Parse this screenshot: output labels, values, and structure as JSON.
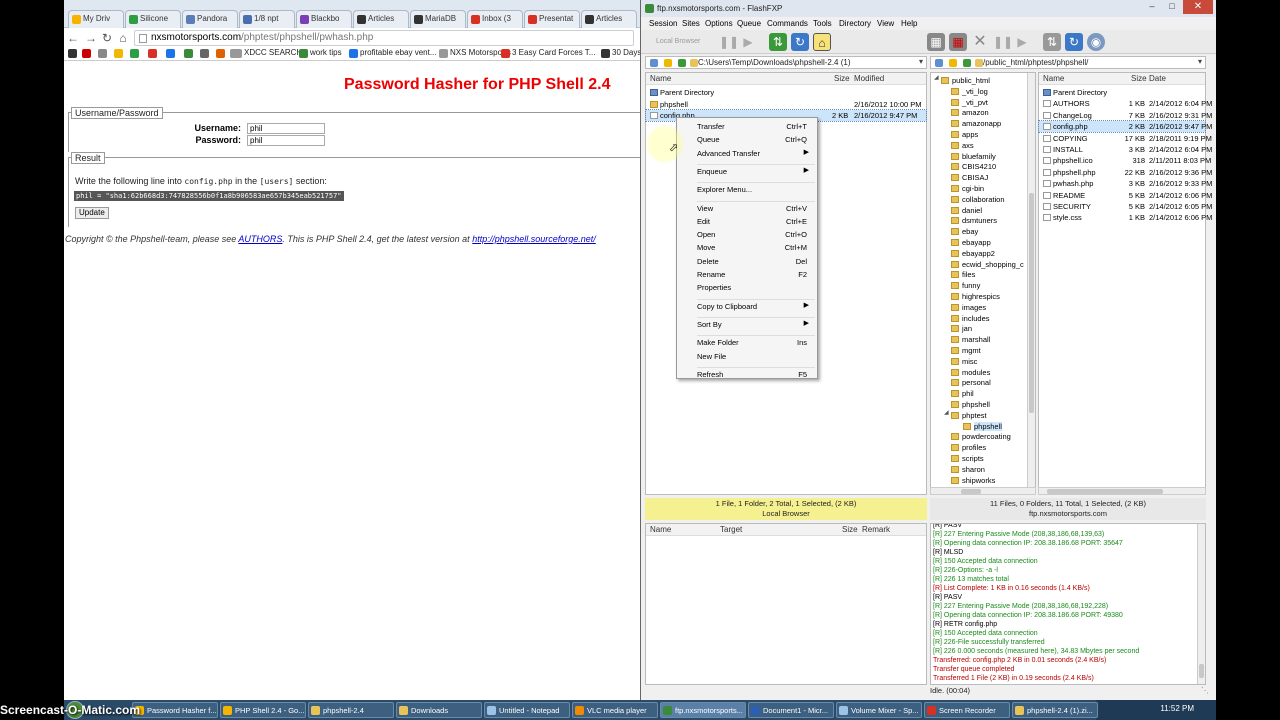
{
  "browser": {
    "tabs": [
      {
        "label": "My Driv",
        "color": "#f4b400"
      },
      {
        "label": "Silicone",
        "color": "#2e9e44"
      },
      {
        "label": "Pandora",
        "color": "#5a7db6"
      },
      {
        "label": "1/8 npt",
        "color": "#4a6fb0"
      },
      {
        "label": "Blackbo",
        "color": "#7a3fb8"
      },
      {
        "label": "Articles",
        "color": "#333333"
      },
      {
        "label": "MariaDB",
        "color": "#333333"
      },
      {
        "label": "Inbox (3",
        "color": "#d93025"
      },
      {
        "label": "Presentat",
        "color": "#d93025"
      },
      {
        "label": "Articles",
        "color": "#333333"
      }
    ],
    "url_host": "nxsmotorsports.com",
    "url_path": "/phptest/phpshell/pwhash.php",
    "bookmarks": [
      {
        "label": "XDCC SEARCH",
        "color": "#999999"
      },
      {
        "label": "work tips",
        "color": "#3a8a3a"
      },
      {
        "label": "profitable ebay vent...",
        "color": "#1a73e8"
      },
      {
        "label": "NXS Motorsports",
        "color": "#999999"
      },
      {
        "label": "3 Easy Card Forces T...",
        "color": "#d93025"
      },
      {
        "label": "30 Days",
        "color": "#333333"
      }
    ],
    "page": {
      "title": "Password Hasher for PHP Shell 2.4",
      "fieldset1_legend": "Username/Password",
      "username_label": "Username:",
      "username_value": "phil",
      "password_label": "Password:",
      "password_value": "phil",
      "fieldset2_legend": "Result",
      "result_pre": "Write the following line into",
      "result_code1": "config.php",
      "result_mid": "in the",
      "result_code2": "[users]",
      "result_post": "section:",
      "hash_line": "phil = \"sha1:62b668d3:747828556b0f1a8b906583ae657b345eab521757\"",
      "update_button": "Update",
      "footer_pre": "Copyright © the Phpshell-team, please see",
      "footer_link1": "AUTHORS",
      "footer_mid": ". This is PHP Shell 2.4, get the latest version at",
      "footer_link2": "http://phpshell.sourceforge.net/"
    }
  },
  "fxp": {
    "title": "ftp.nxsmotorsports.com - FlashFXP",
    "menu": [
      "Session",
      "Sites",
      "Options",
      "Queue",
      "Commands",
      "Tools",
      "Directory",
      "View",
      "Help"
    ],
    "local_browser_label": "Local Browser",
    "local_path": "C:\\Users\\Temp\\Downloads\\phpshell-2.4 (1)",
    "remote_path": "/public_html/phptest/phpshell/",
    "local_headers": {
      "name": "Name",
      "size": "Size",
      "modified": "Modified"
    },
    "local_files": [
      {
        "name": "Parent Directory",
        "size": "",
        "modified": "",
        "kind": "updir"
      },
      {
        "name": "phpshell",
        "size": "",
        "modified": "2/16/2012 10:00 PM",
        "kind": "folder"
      },
      {
        "name": "config.php",
        "size": "2 KB",
        "modified": "2/16/2012 9:47 PM",
        "kind": "file"
      }
    ],
    "tree": [
      "public_html",
      "_vti_log",
      "_vti_pvt",
      "amazon",
      "amazonapp",
      "apps",
      "axs",
      "bluefamily",
      "CBIS4210",
      "CBISAJ",
      "cgi-bin",
      "collaboration",
      "daniel",
      "dsmtuners",
      "ebay",
      "ebayapp",
      "ebayapp2",
      "ecwid_shopping_c",
      "files",
      "funny",
      "highrespics",
      "images",
      "includes",
      "jan",
      "marshall",
      "mgmt",
      "misc",
      "modules",
      "personal",
      "phil",
      "phpshell",
      "phptest",
      "phpshell",
      "powdercoating",
      "profiles",
      "scripts",
      "sharon",
      "shipworks"
    ],
    "remote_headers": {
      "name": "Name",
      "size": "Size",
      "date": "Date"
    },
    "remote_files": [
      {
        "name": "Parent Directory",
        "size": "",
        "date": "",
        "kind": "updir"
      },
      {
        "name": "AUTHORS",
        "size": "1 KB",
        "date": "2/14/2012 6:04 PM",
        "kind": "file"
      },
      {
        "name": "ChangeLog",
        "size": "7 KB",
        "date": "2/16/2012 9:31 PM",
        "kind": "file"
      },
      {
        "name": "config.php",
        "size": "2 KB",
        "date": "2/16/2012 9:47 PM",
        "kind": "file"
      },
      {
        "name": "COPYING",
        "size": "17 KB",
        "date": "2/18/2011 9:19 PM",
        "kind": "file"
      },
      {
        "name": "INSTALL",
        "size": "3 KB",
        "date": "2/14/2012 6:04 PM",
        "kind": "file"
      },
      {
        "name": "phpshell.ico",
        "size": "318",
        "date": "2/11/2011 8:03 PM",
        "kind": "file"
      },
      {
        "name": "phpshell.php",
        "size": "22 KB",
        "date": "2/16/2012 9:36 PM",
        "kind": "file"
      },
      {
        "name": "pwhash.php",
        "size": "3 KB",
        "date": "2/16/2012 9:33 PM",
        "kind": "file"
      },
      {
        "name": "README",
        "size": "5 KB",
        "date": "2/14/2012 6:06 PM",
        "kind": "file"
      },
      {
        "name": "SECURITY",
        "size": "5 KB",
        "date": "2/14/2012 6:05 PM",
        "kind": "file"
      },
      {
        "name": "style.css",
        "size": "1 KB",
        "date": "2/14/2012 6:06 PM",
        "kind": "file"
      }
    ],
    "local_status_line1": "1 File, 1 Folder, 2 Total, 1 Selected, (2 KB)",
    "local_status_line2": "Local Browser",
    "remote_status_line1": "11 Files, 0 Folders, 11 Total, 1 Selected, (2 KB)",
    "remote_status_line2": "ftp.nxsmotorsports.com",
    "queue_headers": {
      "name": "Name",
      "target": "Target",
      "size": "Size",
      "remark": "Remark"
    },
    "log": [
      {
        "text": "[R] PASV",
        "kind": "cmd"
      },
      {
        "text": "[R] 227 Entering Passive Mode (208,38,186,68,139,63)",
        "kind": "resp"
      },
      {
        "text": "[R] Opening data connection IP: 208.38.186.68 PORT: 35647",
        "kind": "resp"
      },
      {
        "text": "[R] MLSD",
        "kind": "cmd"
      },
      {
        "text": "[R] 150 Accepted data connection",
        "kind": "resp"
      },
      {
        "text": "[R] 226-Options: -a -l",
        "kind": "resp"
      },
      {
        "text": "[R] 226 13 matches total",
        "kind": "resp"
      },
      {
        "text": "[R] List Complete: 1 KB in 0.16 seconds (1.4 KB/s)",
        "kind": "local"
      },
      {
        "text": "[R] PASV",
        "kind": "cmd"
      },
      {
        "text": "[R] 227 Entering Passive Mode (208,38,186,68,192,228)",
        "kind": "resp"
      },
      {
        "text": "[R] Opening data connection IP: 208.38.186.68 PORT: 49380",
        "kind": "resp"
      },
      {
        "text": "[R] RETR config.php",
        "kind": "cmd"
      },
      {
        "text": "[R] 150 Accepted data connection",
        "kind": "resp"
      },
      {
        "text": "[R] 226-File successfully transferred",
        "kind": "resp"
      },
      {
        "text": "[R] 226 0.000 seconds (measured here), 34.83 Mbytes per second",
        "kind": "resp"
      },
      {
        "text": "Transferred: config.php 2 KB in 0.01 seconds (2.4 KB/s)",
        "kind": "local"
      },
      {
        "text": "Transfer queue completed",
        "kind": "local"
      },
      {
        "text": "Transferred 1 File (2 KB) in 0.19 seconds (2.4 KB/s)",
        "kind": "local"
      }
    ],
    "idle_status": "Idle. (00:04)"
  },
  "context_menu": [
    {
      "label": "Transfer",
      "key": "Ctrl+T",
      "arrow": false
    },
    {
      "label": "Queue",
      "key": "Ctrl+Q",
      "arrow": false
    },
    {
      "label": "Advanced Transfer",
      "key": "",
      "arrow": true
    },
    {
      "sep": true
    },
    {
      "label": "Enqueue",
      "key": "",
      "arrow": true
    },
    {
      "sep": true
    },
    {
      "label": "Explorer Menu...",
      "key": "",
      "arrow": false
    },
    {
      "sep": true
    },
    {
      "label": "View",
      "key": "Ctrl+V",
      "arrow": false
    },
    {
      "label": "Edit",
      "key": "Ctrl+E",
      "arrow": false
    },
    {
      "label": "Open",
      "key": "Ctrl+O",
      "arrow": false
    },
    {
      "label": "Move",
      "key": "Ctrl+M",
      "arrow": false
    },
    {
      "label": "Delete",
      "key": "Del",
      "arrow": false
    },
    {
      "label": "Rename",
      "key": "F2",
      "arrow": false
    },
    {
      "label": "Properties",
      "key": "",
      "arrow": false
    },
    {
      "sep": true
    },
    {
      "label": "Copy to Clipboard",
      "key": "",
      "arrow": true
    },
    {
      "sep": true
    },
    {
      "label": "Sort By",
      "key": "",
      "arrow": true
    },
    {
      "sep": true
    },
    {
      "label": "Make Folder",
      "key": "Ins",
      "arrow": false
    },
    {
      "label": "New File",
      "key": "",
      "arrow": false
    },
    {
      "sep": true
    },
    {
      "label": "Refresh",
      "key": "F5",
      "arrow": false
    }
  ],
  "taskbar": {
    "items": [
      {
        "label": "Password Hasher f...",
        "color": "#f4b400"
      },
      {
        "label": "PHP Shell 2.4 - Go...",
        "color": "#f4b400"
      },
      {
        "label": "phpshell-2.4",
        "color": "#e8c35a"
      },
      {
        "label": "Downloads",
        "color": "#e8c35a"
      },
      {
        "label": "Untitled - Notepad",
        "color": "#9ec3e8"
      },
      {
        "label": "VLC media player",
        "color": "#f08a00"
      },
      {
        "label": "ftp.nxsmotorsports...",
        "color": "#3a8a3a"
      },
      {
        "label": "Document1 - Micr...",
        "color": "#2b5fb3"
      },
      {
        "label": "Volume Mixer - Sp...",
        "color": "#9ec3e8"
      },
      {
        "label": "Screen Recorder",
        "color": "#d93025"
      },
      {
        "label": "phpshell-2.4 (1).zi...",
        "color": "#e8c35a"
      }
    ],
    "clock": "11:52 PM",
    "watermark": "Screencast-O-Matic.com"
  }
}
